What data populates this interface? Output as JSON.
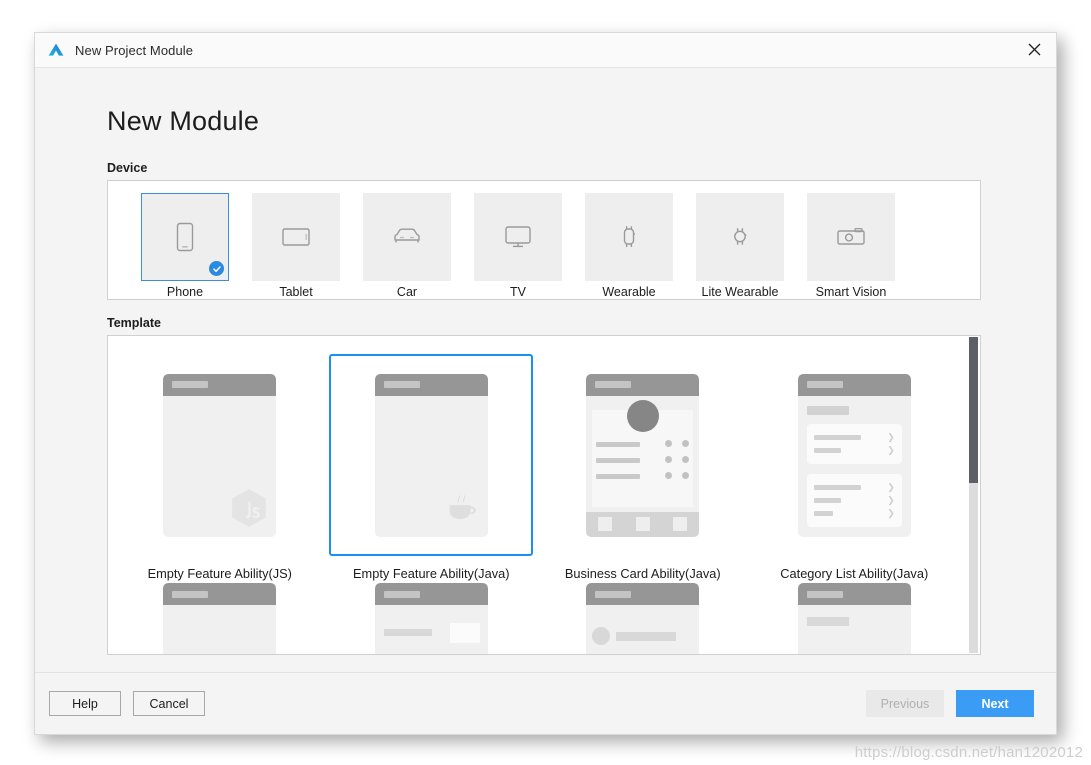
{
  "window": {
    "title": "New Project Module",
    "logo_icon": "hos-triangle-logo-icon",
    "close_icon": "close-icon"
  },
  "page": {
    "heading": "New Module"
  },
  "device_section": {
    "label": "Device",
    "items": [
      {
        "label": "Phone",
        "icon": "phone-icon",
        "selected": true
      },
      {
        "label": "Tablet",
        "icon": "tablet-icon",
        "selected": false
      },
      {
        "label": "Car",
        "icon": "car-icon",
        "selected": false
      },
      {
        "label": "TV",
        "icon": "tv-icon",
        "selected": false
      },
      {
        "label": "Wearable",
        "icon": "wearable-icon",
        "selected": false
      },
      {
        "label": "Lite Wearable",
        "icon": "lite-wearable-icon",
        "selected": false
      },
      {
        "label": "Smart Vision",
        "icon": "camera-icon",
        "selected": false
      }
    ],
    "selected_badge_icon": "check-circle-icon"
  },
  "template_section": {
    "label": "Template",
    "items": [
      {
        "label": "Empty Feature Ability(JS)",
        "mock": "empty-js",
        "selected": false
      },
      {
        "label": "Empty Feature Ability(Java)",
        "mock": "empty-java",
        "selected": true
      },
      {
        "label": "Business Card Ability(Java)",
        "mock": "business-card",
        "selected": false
      },
      {
        "label": "Category List Ability(Java)",
        "mock": "category-list",
        "selected": false
      }
    ],
    "row2_items": [
      {
        "mock": "row2-plain"
      },
      {
        "mock": "row2-dialog"
      },
      {
        "mock": "row2-avatar"
      },
      {
        "mock": "row2-title"
      }
    ],
    "scrollbar": {
      "name": "vertical-scrollbar"
    }
  },
  "footer": {
    "help_label": "Help",
    "cancel_label": "Cancel",
    "previous_label": "Previous",
    "next_label": "Next",
    "previous_disabled": true
  },
  "watermark": "https://blog.csdn.net/han1202012",
  "colors": {
    "accent": "#3b9cf5",
    "selection_border": "#1a90f0",
    "device_selection_border": "#3c8fdc",
    "badge": "#2a8ae0",
    "dialog_bg": "#f4f4f4",
    "panel_bg": "#ffffff",
    "mock_header": "#969696"
  }
}
